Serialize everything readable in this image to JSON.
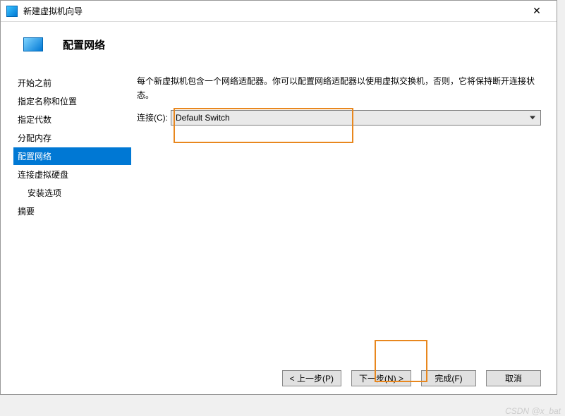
{
  "window": {
    "title": "新建虚拟机向导"
  },
  "header": {
    "title": "配置网络"
  },
  "sidebar": {
    "items": [
      {
        "label": "开始之前",
        "active": false,
        "indent": false
      },
      {
        "label": "指定名称和位置",
        "active": false,
        "indent": false
      },
      {
        "label": "指定代数",
        "active": false,
        "indent": false
      },
      {
        "label": "分配内存",
        "active": false,
        "indent": false
      },
      {
        "label": "配置网络",
        "active": true,
        "indent": false
      },
      {
        "label": "连接虚拟硬盘",
        "active": false,
        "indent": false
      },
      {
        "label": "安装选项",
        "active": false,
        "indent": true
      },
      {
        "label": "摘要",
        "active": false,
        "indent": false
      }
    ]
  },
  "content": {
    "description": "每个新虚拟机包含一个网络适配器。你可以配置网络适配器以使用虚拟交换机，否则，它将保持断开连接状态。",
    "connection_label": "连接(C):",
    "connection_value": "Default Switch"
  },
  "footer": {
    "prev": "< 上一步(P)",
    "next": "下一步(N) >",
    "finish": "完成(F)",
    "cancel": "取消"
  },
  "watermark": "CSDN @x_bat"
}
